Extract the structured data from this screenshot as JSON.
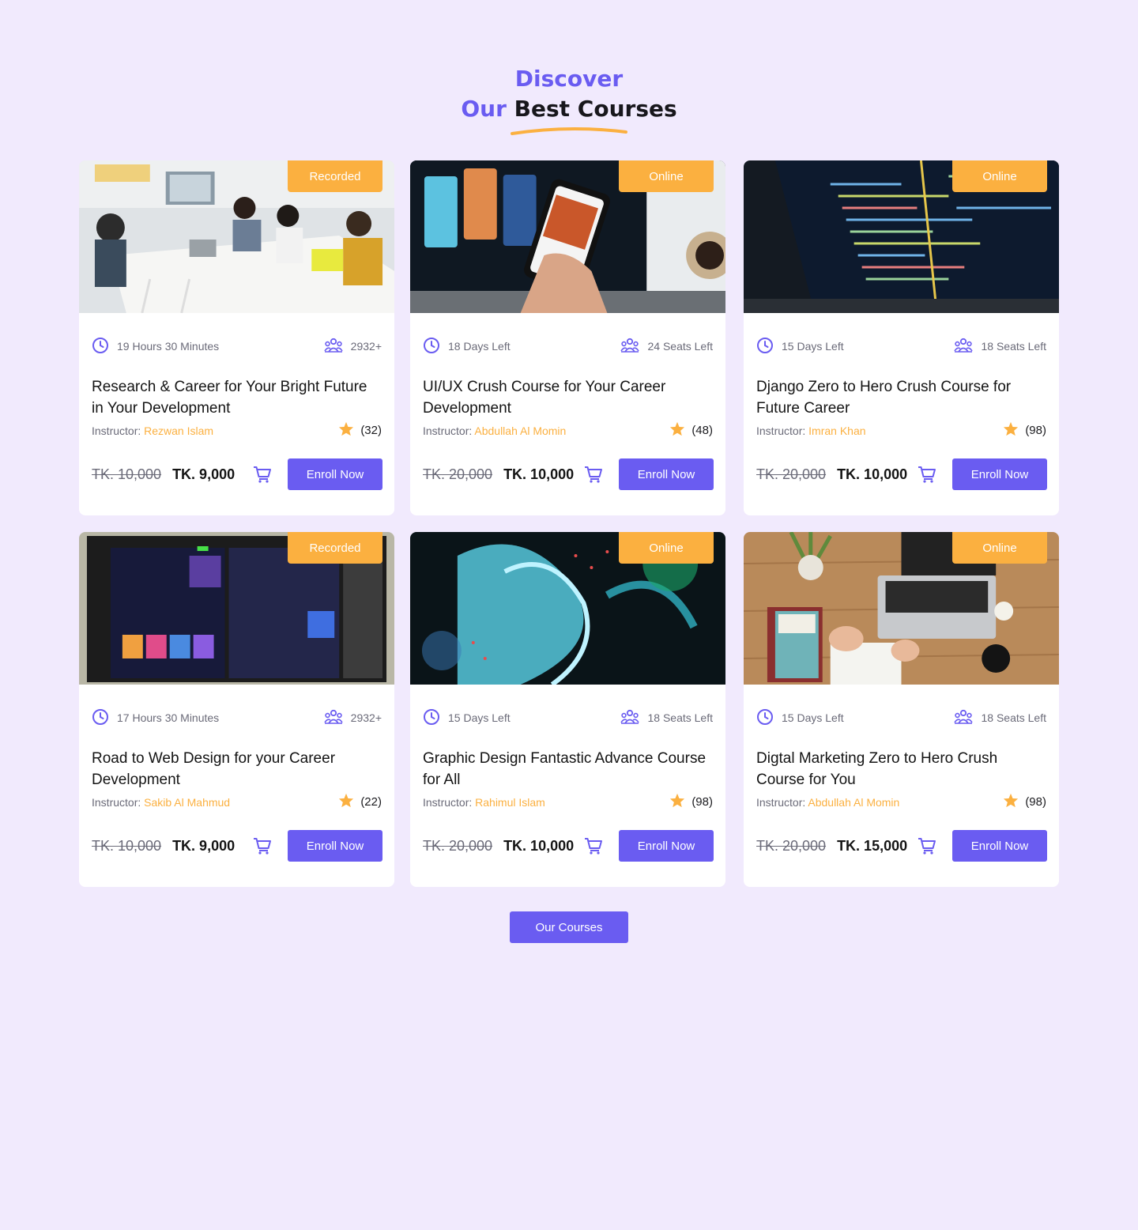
{
  "section": {
    "line1": "Discover",
    "line2_accent": "Our",
    "line2_rest": "Best Courses",
    "more_button": "Our Courses"
  },
  "courses": [
    {
      "badge": "Recorded",
      "duration": "19 Hours 30 Minutes",
      "seats": "2932+",
      "title": "Research & Career for Your Bright Future in Your Development",
      "instructor_label": "Instructor:",
      "instructor": "Rezwan Islam",
      "rating": "(32)",
      "old_price": "TK. 10,000",
      "price": "TK. 9,000",
      "enroll": "Enroll Now",
      "image": "office-meeting"
    },
    {
      "badge": "Online",
      "duration": "18 Days Left",
      "seats": "24 Seats Left",
      "title": "UI/UX  Crush Course for Your Career Development",
      "instructor_label": "Instructor:",
      "instructor": "Abdullah Al Momin",
      "rating": "(48)",
      "old_price": "TK. 20,000",
      "price": "TK. 10,000",
      "enroll": "Enroll Now",
      "image": "phone-ui"
    },
    {
      "badge": "Online",
      "duration": "15 Days Left",
      "seats": "18 Seats Left",
      "title": "Django Zero to Hero Crush Course for Future Career",
      "instructor_label": "Instructor:",
      "instructor": "Imran Khan",
      "rating": "(98)",
      "old_price": "TK. 20,000",
      "price": "TK. 10,000",
      "enroll": "Enroll Now",
      "image": "code-screen"
    },
    {
      "badge": "Recorded",
      "duration": "17 Hours 30 Minutes",
      "seats": "2932+",
      "title": "Road to Web Design for your Career Development",
      "instructor_label": "Instructor:",
      "instructor": "Sakib Al Mahmud",
      "rating": "(22)",
      "old_price": "TK. 10,000",
      "price": "TK. 9,000",
      "enroll": "Enroll Now",
      "image": "web-design-monitor"
    },
    {
      "badge": "Online",
      "duration": "15 Days Left",
      "seats": "18 Seats Left",
      "title": "Graphic Design Fantastic Advance Course for All",
      "instructor_label": "Instructor:",
      "instructor": "Rahimul Islam",
      "rating": "(98)",
      "old_price": "TK. 20,000",
      "price": "TK. 10,000",
      "enroll": "Enroll Now",
      "image": "abstract-glass"
    },
    {
      "badge": "Online",
      "duration": "15 Days Left",
      "seats": "18 Seats Left",
      "title": "Digtal Marketing Zero to Hero Crush Course for You",
      "instructor_label": "Instructor:",
      "instructor": "Abdullah Al Momin",
      "rating": "(98)",
      "old_price": "TK. 20,000",
      "price": "TK. 15,000",
      "enroll": "Enroll Now",
      "image": "desk-laptop"
    }
  ],
  "colors": {
    "background": "#f1eafd",
    "primary": "#6a5cf1",
    "accent": "#fbb040"
  },
  "icons": [
    "clock-icon",
    "users-icon",
    "star-icon",
    "cart-icon"
  ]
}
